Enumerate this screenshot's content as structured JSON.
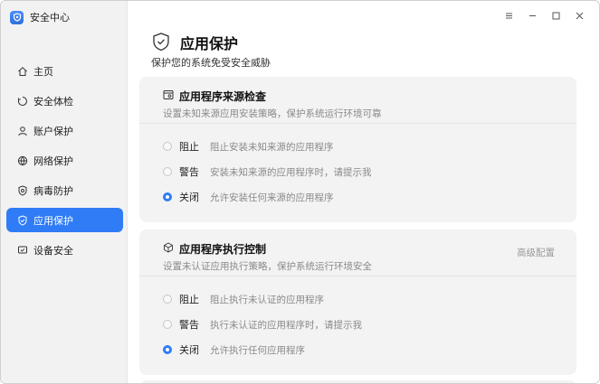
{
  "app": {
    "name": "安全中心"
  },
  "sidebar": {
    "items": [
      {
        "label": "主页",
        "icon": "home-icon"
      },
      {
        "label": "安全体检",
        "icon": "scan-icon"
      },
      {
        "label": "账户保护",
        "icon": "user-icon"
      },
      {
        "label": "网络保护",
        "icon": "globe-icon"
      },
      {
        "label": "病毒防护",
        "icon": "virus-shield-icon"
      },
      {
        "label": "应用保护",
        "icon": "app-shield-icon",
        "active": true
      },
      {
        "label": "设备安全",
        "icon": "device-icon"
      }
    ]
  },
  "page": {
    "title": "应用保护",
    "subtitle": "保护您的系统免受安全威胁"
  },
  "card1": {
    "title": "应用程序来源检查",
    "desc": "设置未知来源应用安装策略，保护系统运行环境可靠",
    "options": [
      {
        "label": "阻止",
        "desc": "阻止安装未知来源的应用程序",
        "checked": false
      },
      {
        "label": "警告",
        "desc": "安装未知来源的应用程序时，请提示我",
        "checked": false
      },
      {
        "label": "关闭",
        "desc": "允许安装任何来源的应用程序",
        "checked": true
      }
    ]
  },
  "card2": {
    "title": "应用程序执行控制",
    "desc": "设置未认证应用执行策略，保护系统运行环境安全",
    "advanced": "高级配置",
    "options": [
      {
        "label": "阻止",
        "desc": "阻止执行未认证的应用程序",
        "checked": false
      },
      {
        "label": "警告",
        "desc": "执行未认证的应用程序时，请提示我",
        "checked": false
      },
      {
        "label": "关闭",
        "desc": "允许执行任何应用程序",
        "checked": true
      }
    ]
  },
  "colors": {
    "accent": "#2f7cf6",
    "sidebar_bg": "#f2f2f2",
    "card_bg": "#f3f3f3"
  }
}
